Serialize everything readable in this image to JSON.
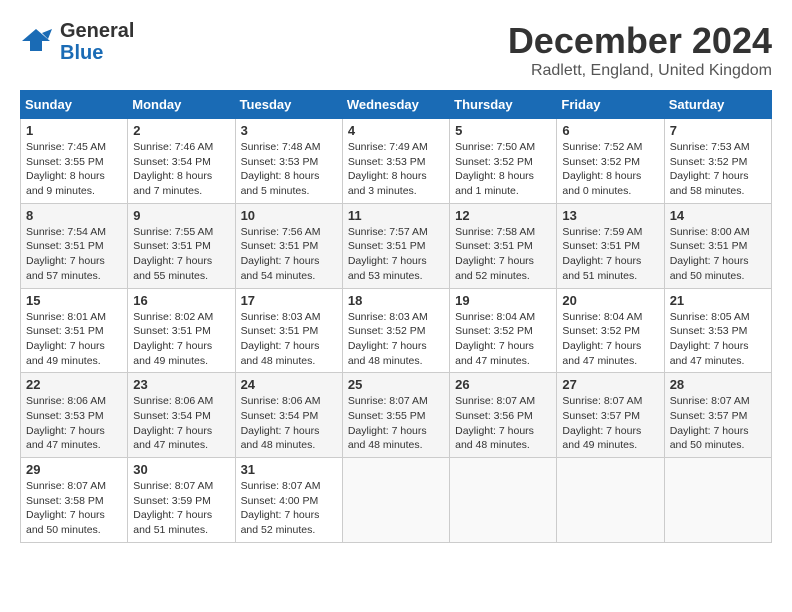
{
  "logo": {
    "line1": "General",
    "line2": "Blue"
  },
  "title": "December 2024",
  "subtitle": "Radlett, England, United Kingdom",
  "days_header": [
    "Sunday",
    "Monday",
    "Tuesday",
    "Wednesday",
    "Thursday",
    "Friday",
    "Saturday"
  ],
  "weeks": [
    [
      {
        "day": "1",
        "info": "Sunrise: 7:45 AM\nSunset: 3:55 PM\nDaylight: 8 hours and 9 minutes."
      },
      {
        "day": "2",
        "info": "Sunrise: 7:46 AM\nSunset: 3:54 PM\nDaylight: 8 hours and 7 minutes."
      },
      {
        "day": "3",
        "info": "Sunrise: 7:48 AM\nSunset: 3:53 PM\nDaylight: 8 hours and 5 minutes."
      },
      {
        "day": "4",
        "info": "Sunrise: 7:49 AM\nSunset: 3:53 PM\nDaylight: 8 hours and 3 minutes."
      },
      {
        "day": "5",
        "info": "Sunrise: 7:50 AM\nSunset: 3:52 PM\nDaylight: 8 hours and 1 minute."
      },
      {
        "day": "6",
        "info": "Sunrise: 7:52 AM\nSunset: 3:52 PM\nDaylight: 8 hours and 0 minutes."
      },
      {
        "day": "7",
        "info": "Sunrise: 7:53 AM\nSunset: 3:52 PM\nDaylight: 7 hours and 58 minutes."
      }
    ],
    [
      {
        "day": "8",
        "info": "Sunrise: 7:54 AM\nSunset: 3:51 PM\nDaylight: 7 hours and 57 minutes."
      },
      {
        "day": "9",
        "info": "Sunrise: 7:55 AM\nSunset: 3:51 PM\nDaylight: 7 hours and 55 minutes."
      },
      {
        "day": "10",
        "info": "Sunrise: 7:56 AM\nSunset: 3:51 PM\nDaylight: 7 hours and 54 minutes."
      },
      {
        "day": "11",
        "info": "Sunrise: 7:57 AM\nSunset: 3:51 PM\nDaylight: 7 hours and 53 minutes."
      },
      {
        "day": "12",
        "info": "Sunrise: 7:58 AM\nSunset: 3:51 PM\nDaylight: 7 hours and 52 minutes."
      },
      {
        "day": "13",
        "info": "Sunrise: 7:59 AM\nSunset: 3:51 PM\nDaylight: 7 hours and 51 minutes."
      },
      {
        "day": "14",
        "info": "Sunrise: 8:00 AM\nSunset: 3:51 PM\nDaylight: 7 hours and 50 minutes."
      }
    ],
    [
      {
        "day": "15",
        "info": "Sunrise: 8:01 AM\nSunset: 3:51 PM\nDaylight: 7 hours and 49 minutes."
      },
      {
        "day": "16",
        "info": "Sunrise: 8:02 AM\nSunset: 3:51 PM\nDaylight: 7 hours and 49 minutes."
      },
      {
        "day": "17",
        "info": "Sunrise: 8:03 AM\nSunset: 3:51 PM\nDaylight: 7 hours and 48 minutes."
      },
      {
        "day": "18",
        "info": "Sunrise: 8:03 AM\nSunset: 3:52 PM\nDaylight: 7 hours and 48 minutes."
      },
      {
        "day": "19",
        "info": "Sunrise: 8:04 AM\nSunset: 3:52 PM\nDaylight: 7 hours and 47 minutes."
      },
      {
        "day": "20",
        "info": "Sunrise: 8:04 AM\nSunset: 3:52 PM\nDaylight: 7 hours and 47 minutes."
      },
      {
        "day": "21",
        "info": "Sunrise: 8:05 AM\nSunset: 3:53 PM\nDaylight: 7 hours and 47 minutes."
      }
    ],
    [
      {
        "day": "22",
        "info": "Sunrise: 8:06 AM\nSunset: 3:53 PM\nDaylight: 7 hours and 47 minutes."
      },
      {
        "day": "23",
        "info": "Sunrise: 8:06 AM\nSunset: 3:54 PM\nDaylight: 7 hours and 47 minutes."
      },
      {
        "day": "24",
        "info": "Sunrise: 8:06 AM\nSunset: 3:54 PM\nDaylight: 7 hours and 48 minutes."
      },
      {
        "day": "25",
        "info": "Sunrise: 8:07 AM\nSunset: 3:55 PM\nDaylight: 7 hours and 48 minutes."
      },
      {
        "day": "26",
        "info": "Sunrise: 8:07 AM\nSunset: 3:56 PM\nDaylight: 7 hours and 48 minutes."
      },
      {
        "day": "27",
        "info": "Sunrise: 8:07 AM\nSunset: 3:57 PM\nDaylight: 7 hours and 49 minutes."
      },
      {
        "day": "28",
        "info": "Sunrise: 8:07 AM\nSunset: 3:57 PM\nDaylight: 7 hours and 50 minutes."
      }
    ],
    [
      {
        "day": "29",
        "info": "Sunrise: 8:07 AM\nSunset: 3:58 PM\nDaylight: 7 hours and 50 minutes."
      },
      {
        "day": "30",
        "info": "Sunrise: 8:07 AM\nSunset: 3:59 PM\nDaylight: 7 hours and 51 minutes."
      },
      {
        "day": "31",
        "info": "Sunrise: 8:07 AM\nSunset: 4:00 PM\nDaylight: 7 hours and 52 minutes."
      },
      {
        "day": "",
        "info": ""
      },
      {
        "day": "",
        "info": ""
      },
      {
        "day": "",
        "info": ""
      },
      {
        "day": "",
        "info": ""
      }
    ]
  ]
}
